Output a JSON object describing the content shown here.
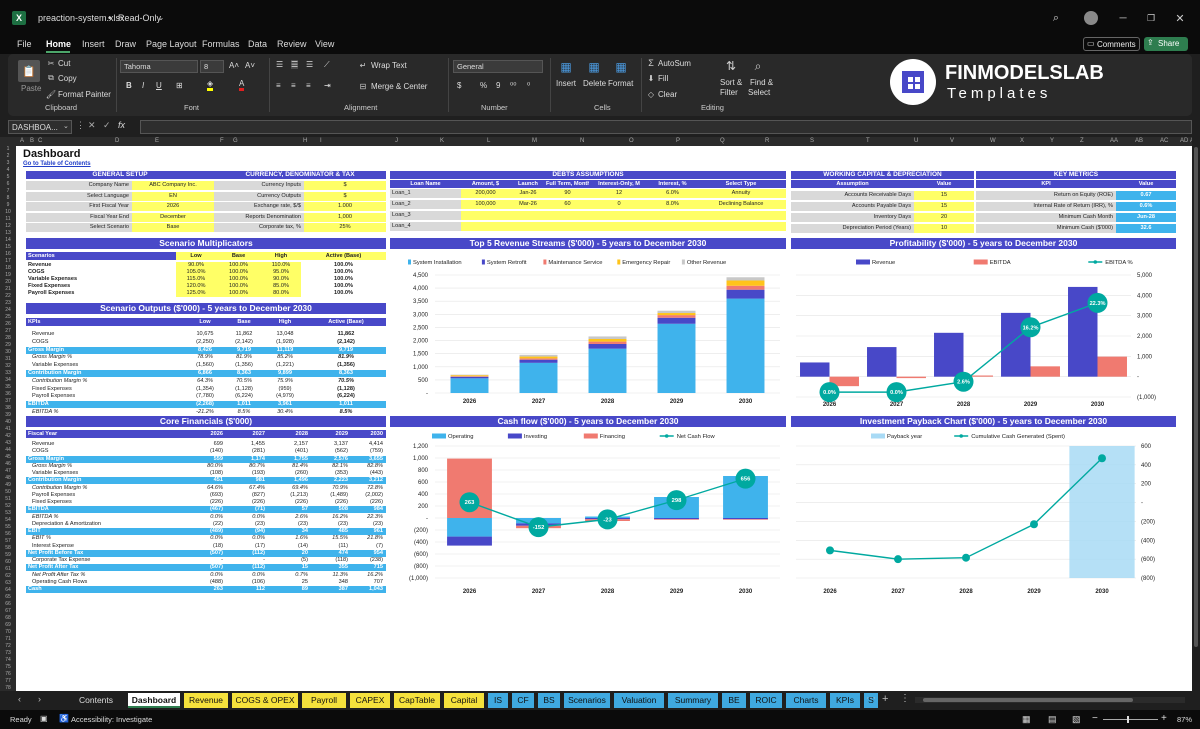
{
  "title": {
    "file": "preaction-system.xlsx",
    "mode": "Read-Only"
  },
  "menu": [
    "File",
    "Home",
    "Insert",
    "Draw",
    "Page Layout",
    "Formulas",
    "Data",
    "Review",
    "View"
  ],
  "comments_label": "Comments",
  "share_label": "Share",
  "ribbon": {
    "paste": "Paste",
    "cut": "Cut",
    "copy": "Copy",
    "format_painter": "Format Painter",
    "clipboard": "Clipboard",
    "font_name": "Tahoma",
    "font_size": "8",
    "font": "Font",
    "wrap": "Wrap Text",
    "merge": "Merge & Center",
    "alignment": "Alignment",
    "number_format": "General",
    "number": "Number",
    "insert": "Insert",
    "delete": "Delete",
    "format": "Format",
    "cells": "Cells",
    "autosum": "AutoSum",
    "fill": "Fill",
    "clear": "Clear",
    "sort": "Sort &",
    "filter": "Filter",
    "find": "Find &",
    "select": "Select",
    "editing": "Editing"
  },
  "logo": {
    "brand": "FINMODELSLAB",
    "sub": "Templates"
  },
  "namebox": "DASHBOA...",
  "fx": "fx",
  "columns": [
    "A",
    "B",
    "C",
    "D",
    "E",
    "F",
    "G",
    "H",
    "I",
    "J",
    "K",
    "L",
    "M",
    "N",
    "O",
    "P",
    "Q",
    "R",
    "S",
    "T",
    "U",
    "V",
    "W",
    "X",
    "Y",
    "Z",
    "AA",
    "AB",
    "AC",
    "AD",
    "AE"
  ],
  "dash": {
    "title": "Dashboard",
    "link": "Go to Table of Contents"
  },
  "general": {
    "header": "GENERAL SETUP",
    "rows": [
      [
        "Company Name",
        "ABC Company Inc."
      ],
      [
        "Select Language",
        "EN"
      ],
      [
        "First Fiscal Year",
        "2026"
      ],
      [
        "Fiscal Year End",
        "December"
      ],
      [
        "Select Scenario",
        "Base"
      ]
    ]
  },
  "currency": {
    "header": "CURRENCY, DENOMINATOR & TAX",
    "rows": [
      [
        "Currency Inputs",
        "$"
      ],
      [
        "Currency Outputs",
        "$"
      ],
      [
        "Exchange rate, $/$",
        "1.000"
      ],
      [
        "Reports Denomination",
        "1,000"
      ],
      [
        "Corporate tax, %",
        "25%"
      ]
    ]
  },
  "debts": {
    "header": "DEBTS ASSUMPTIONS",
    "cols": [
      "Loan Name",
      "Amount, $",
      "Launch",
      "Full Term, Months",
      "Interest-Only, M",
      "Interest, %",
      "Select Type"
    ],
    "rows": [
      [
        "Loan_1",
        "200,000",
        "Jan-26",
        "90",
        "12",
        "6.0%",
        "Annuity"
      ],
      [
        "Loan_2",
        "100,000",
        "Mar-26",
        "60",
        "0",
        "8.0%",
        "Declining Balance"
      ],
      [
        "Loan_3",
        "",
        "",
        "",
        "",
        "",
        ""
      ],
      [
        "Loan_4",
        "",
        "",
        "",
        "",
        "",
        ""
      ]
    ]
  },
  "wc": {
    "header": "WORKING CAPITAL & DEPRECIATION",
    "cols": [
      "Assumption",
      "Value"
    ],
    "rows": [
      [
        "Accounts Receivable Days",
        "15"
      ],
      [
        "Accounts Payable Days",
        "15"
      ],
      [
        "Inventory Days",
        "20"
      ],
      [
        "Depreciation Period (Years)",
        "10"
      ]
    ]
  },
  "kpi": {
    "header": "KEY METRICS",
    "cols": [
      "KPI",
      "Value"
    ],
    "rows": [
      [
        "Return on Equity (ROE)",
        "0.67"
      ],
      [
        "Internal Rate of Return (IRR), %",
        "0.6%"
      ],
      [
        "Minimum Cash Month",
        "Jun-28"
      ],
      [
        "Minimum Cash ($'000)",
        "32.6"
      ]
    ]
  },
  "mult": {
    "header": "Scenario Multiplicators",
    "cols": [
      "Scenarios",
      "Low",
      "Base",
      "High",
      "Active (Base)"
    ],
    "rows": [
      [
        "Revenue",
        "90.0%",
        "100.0%",
        "110.0%",
        "100.0%"
      ],
      [
        "COGS",
        "105.0%",
        "100.0%",
        "95.0%",
        "100.0%"
      ],
      [
        "Variable Expenses",
        "115.0%",
        "100.0%",
        "90.0%",
        "100.0%"
      ],
      [
        "Fixed Expenses",
        "120.0%",
        "100.0%",
        "85.0%",
        "100.0%"
      ],
      [
        "Payroll Expenses",
        "125.0%",
        "100.0%",
        "80.0%",
        "100.0%"
      ]
    ]
  },
  "outputs": {
    "header": "Scenario Outputs ($'000) - 5 years to December 2030",
    "cols": [
      "KPIs",
      "Low",
      "Base",
      "High",
      "Active (Base)"
    ],
    "rows": [
      [
        "Revenue",
        "10,675",
        "11,862",
        "13,048",
        "11,862",
        "n"
      ],
      [
        "COGS",
        "(2,250)",
        "(2,142)",
        "(1,928)",
        "(2,142)",
        "n"
      ],
      [
        "Gross Margin",
        "8,426",
        "9,719",
        "11,119",
        "9,719",
        "h"
      ],
      [
        "Gross Margin %",
        "78.9%",
        "81.9%",
        "85.2%",
        "81.9%",
        "i"
      ],
      [
        "Variable Expenses",
        "(1,560)",
        "(1,356)",
        "(1,221)",
        "(1,356)",
        "n"
      ],
      [
        "Contribution Margin",
        "6,866",
        "8,363",
        "9,899",
        "8,363",
        "h"
      ],
      [
        "Contribution Margin %",
        "64.3%",
        "70.5%",
        "75.9%",
        "70.5%",
        "i"
      ],
      [
        "Fixed Expenses",
        "(1,354)",
        "(1,128)",
        "(959)",
        "(1,128)",
        "n"
      ],
      [
        "Payroll Expenses",
        "(7,780)",
        "(6,224)",
        "(4,979)",
        "(6,224)",
        "n"
      ],
      [
        "EBITDA",
        "(2,268)",
        "1,011",
        "3,961",
        "1,011",
        "h"
      ],
      [
        "EBITDA %",
        "-21.2%",
        "8.5%",
        "30.4%",
        "8.5%",
        "i"
      ]
    ]
  },
  "core": {
    "header": "Core Financials ($'000)",
    "cols": [
      "Fiscal Year",
      "2026",
      "2027",
      "2028",
      "2029",
      "2030"
    ],
    "rows": [
      [
        "Revenue",
        "699",
        "1,455",
        "2,157",
        "3,137",
        "4,414",
        "n"
      ],
      [
        "COGS",
        "(140)",
        "(281)",
        "(401)",
        "(562)",
        "(759)",
        "n"
      ],
      [
        "Gross Margin",
        "559",
        "1,174",
        "1,755",
        "2,576",
        "3,655",
        "h"
      ],
      [
        "Gross Margin %",
        "80.0%",
        "80.7%",
        "81.4%",
        "82.1%",
        "82.8%",
        "i"
      ],
      [
        "Variable Expenses",
        "(108)",
        "(193)",
        "(260)",
        "(353)",
        "(443)",
        "n"
      ],
      [
        "Contribution Margin",
        "451",
        "981",
        "1,496",
        "2,223",
        "3,212",
        "h"
      ],
      [
        "Contribution Margin %",
        "64.6%",
        "67.4%",
        "69.4%",
        "70.9%",
        "72.8%",
        "i"
      ],
      [
        "Payroll Expenses",
        "(693)",
        "(827)",
        "(1,213)",
        "(1,489)",
        "(2,002)",
        "n"
      ],
      [
        "Fixed Expenses",
        "(226)",
        "(226)",
        "(226)",
        "(226)",
        "(226)",
        "n"
      ],
      [
        "EBITDA",
        "(467)",
        "(71)",
        "57",
        "508",
        "984",
        "h"
      ],
      [
        "EBITDA %",
        "0.0%",
        "0.0%",
        "2.6%",
        "16.2%",
        "22.3%",
        "i"
      ],
      [
        "Depreciation & Amortization",
        "(22)",
        "(23)",
        "(23)",
        "(23)",
        "(23)",
        "n"
      ],
      [
        "EBIT",
        "(489)",
        "(94)",
        "34",
        "485",
        "961",
        "h"
      ],
      [
        "EBIT %",
        "0.0%",
        "0.0%",
        "1.6%",
        "15.5%",
        "21.8%",
        "i"
      ],
      [
        "Interest Expense",
        "(18)",
        "(17)",
        "(14)",
        "(11)",
        "(7)",
        "n"
      ],
      [
        "Net Profit Before Tax",
        "(507)",
        "(112)",
        "20",
        "474",
        "954",
        "h"
      ],
      [
        "Corporate Tax Expense",
        "-",
        "-",
        "(5)",
        "(118)",
        "(238)",
        "n"
      ],
      [
        "Net Profit After Tax",
        "(507)",
        "(112)",
        "15",
        "355",
        "715",
        "h"
      ],
      [
        "Net Profit After Tax %",
        "0.0%",
        "0.0%",
        "0.7%",
        "11.3%",
        "16.2%",
        "i"
      ],
      [
        "Operating Cash Flows",
        "(488)",
        "(106)",
        "25",
        "348",
        "707",
        "n"
      ],
      [
        "Cash",
        "263",
        "112",
        "89",
        "387",
        "1,043",
        "h"
      ]
    ]
  },
  "colors": {
    "header": "#4848c8",
    "highlight": "#3fb3ec",
    "input": "#ffff66",
    "label_bg": "#d9d9d9",
    "accent": "#00a9a0"
  },
  "chart_data": [
    {
      "type": "bar",
      "title": "Top 5 Revenue Streams ($'000) - 5 years to December 2030",
      "categories": [
        "2026",
        "2027",
        "2028",
        "2029",
        "2030"
      ],
      "ylim": [
        0,
        4500
      ],
      "yticks": [
        "-",
        "500",
        "1,000",
        "1,500",
        "2,000",
        "2,500",
        "3,000",
        "3,500",
        "4,000",
        "4,500"
      ],
      "series": [
        {
          "name": "System Installation",
          "color": "#3fb3ec",
          "values": [
            560,
            1150,
            1690,
            2640,
            3600
          ]
        },
        {
          "name": "System Retrofit",
          "color": "#4848c8",
          "values": [
            60,
            120,
            180,
            230,
            340
          ]
        },
        {
          "name": "Maintenance Service",
          "color": "#f07a70",
          "values": [
            20,
            50,
            90,
            100,
            150
          ]
        },
        {
          "name": "Emergency Repair",
          "color": "#ffc41a",
          "values": [
            40,
            70,
            100,
            80,
            200
          ]
        },
        {
          "name": "Other Revenue",
          "color": "#c8c8c8",
          "values": [
            19,
            65,
            97,
            87,
            124
          ]
        }
      ]
    },
    {
      "type": "bar",
      "title": "Profitability ($'000) - 5 years to December 2030",
      "categories": [
        "2026",
        "2027",
        "2028",
        "2029",
        "2030"
      ],
      "ylim": [
        -1000,
        5000
      ],
      "yticks": [
        "(1,000)",
        "-",
        "1,000",
        "2,000",
        "3,000",
        "4,000",
        "5,000"
      ],
      "series": [
        {
          "name": "Revenue",
          "color": "#4848c8",
          "values": [
            699,
            1455,
            2157,
            3137,
            4414
          ]
        },
        {
          "name": "EBITDA",
          "color": "#f07a70",
          "values": [
            -467,
            -71,
            57,
            508,
            984
          ]
        }
      ],
      "line": {
        "name": "EBITDA %",
        "color": "#00a9a0",
        "values": [
          0,
          0,
          2.6,
          16.2,
          22.3
        ],
        "labels": [
          "0.0%",
          "0.0%",
          "2.6%",
          "16.2%",
          "22.3%"
        ],
        "max": 25
      }
    },
    {
      "type": "bar",
      "title": "Cash flow ($'000) - 5 years to December 2030",
      "categories": [
        "2026",
        "2027",
        "2028",
        "2029",
        "2030"
      ],
      "ylim": [
        -1000,
        1200
      ],
      "yticks": [
        "(1,000)",
        "(800)",
        "(600)",
        "(400)",
        "(200)",
        "-",
        "200",
        "400",
        "600",
        "800",
        "1,000",
        "1,200"
      ],
      "series": [
        {
          "name": "Operating",
          "color": "#3fb3ec",
          "values": [
            -310,
            -90,
            25,
            350,
            700
          ]
        },
        {
          "name": "Investing",
          "color": "#4848c8",
          "values": [
            -150,
            -40,
            -20,
            -20,
            -20
          ]
        },
        {
          "name": "Financing",
          "color": "#f07a70",
          "values": [
            990,
            -40,
            -30,
            -10,
            -10
          ]
        }
      ],
      "line": {
        "name": "Net Cash Flow",
        "color": "#00a9a0",
        "values": [
          263,
          -152,
          -23,
          298,
          656
        ],
        "labels": [
          "263",
          "-152",
          "-23",
          "298",
          "656"
        ]
      }
    },
    {
      "type": "bar",
      "title": "Investment Payback Chart ($'000) - 5 years to December 2030",
      "categories": [
        "2026",
        "2027",
        "2028",
        "2029",
        "2030"
      ],
      "ylim": [
        -800,
        600
      ],
      "yticks": [
        "(800)",
        "(600)",
        "(400)",
        "(200)",
        "-",
        "200",
        "400",
        "600"
      ],
      "series": [
        {
          "name": "Payback year",
          "color": "#a8daf5",
          "values": [
            0,
            0,
            0,
            0,
            1
          ]
        }
      ],
      "line": {
        "name": "Cumulative Cash Generated (Spent)",
        "color": "#00a9a0",
        "values": [
          -507,
          -600,
          -585,
          -230,
          470
        ]
      }
    }
  ],
  "tabs": [
    {
      "label": "Contents",
      "bg": "#1f1f1f",
      "fg": "#ddd"
    },
    {
      "label": "Dashboard",
      "bg": "#ffffff",
      "fg": "#111"
    },
    {
      "label": "Revenue",
      "bg": "#f5e13c"
    },
    {
      "label": "COGS & OPEX",
      "bg": "#f5e13c"
    },
    {
      "label": "Payroll",
      "bg": "#f5e13c"
    },
    {
      "label": "CAPEX",
      "bg": "#f5e13c"
    },
    {
      "label": "CapTable",
      "bg": "#f5e13c"
    },
    {
      "label": "Capital",
      "bg": "#f5e13c"
    },
    {
      "label": "IS",
      "bg": "#3fa9e0"
    },
    {
      "label": "CF",
      "bg": "#3fa9e0"
    },
    {
      "label": "BS",
      "bg": "#3fa9e0"
    },
    {
      "label": "Scenarios",
      "bg": "#3fa9e0"
    },
    {
      "label": "Valuation",
      "bg": "#3fa9e0"
    },
    {
      "label": "Summary",
      "bg": "#3fa9e0"
    },
    {
      "label": "BE",
      "bg": "#3fa9e0"
    },
    {
      "label": "ROIC",
      "bg": "#3fa9e0"
    },
    {
      "label": "Charts",
      "bg": "#3fa9e0"
    },
    {
      "label": "KPIs",
      "bg": "#3fa9e0"
    },
    {
      "label": "S",
      "bg": "#3fa9e0"
    }
  ],
  "status": {
    "ready": "Ready",
    "accessibility": "Accessibility: Investigate",
    "zoom": "87%"
  }
}
